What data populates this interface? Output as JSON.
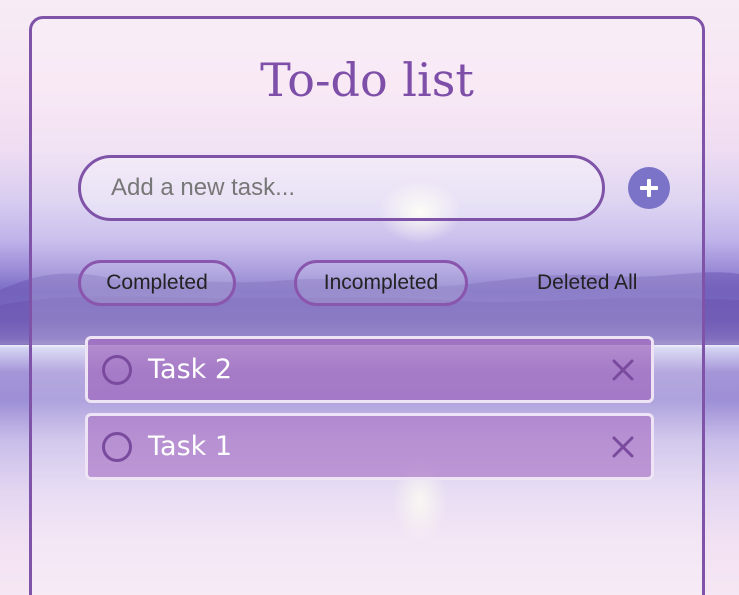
{
  "app": {
    "title": "To-do list"
  },
  "input": {
    "placeholder": "Add a new task...",
    "value": ""
  },
  "add_button": {
    "icon": "plus-icon"
  },
  "filters": {
    "completed_label": "Completed",
    "incompleted_label": "Incompleted",
    "delete_all_label": "Deleted All"
  },
  "tasks": [
    {
      "label": "Task 2",
      "completed": false
    },
    {
      "label": "Task 1",
      "completed": false
    }
  ],
  "colors": {
    "accent": "#7f53a8",
    "add_button": "#7a73c7",
    "task_bg": "#a06abe",
    "task_border": "#efe4f6"
  }
}
